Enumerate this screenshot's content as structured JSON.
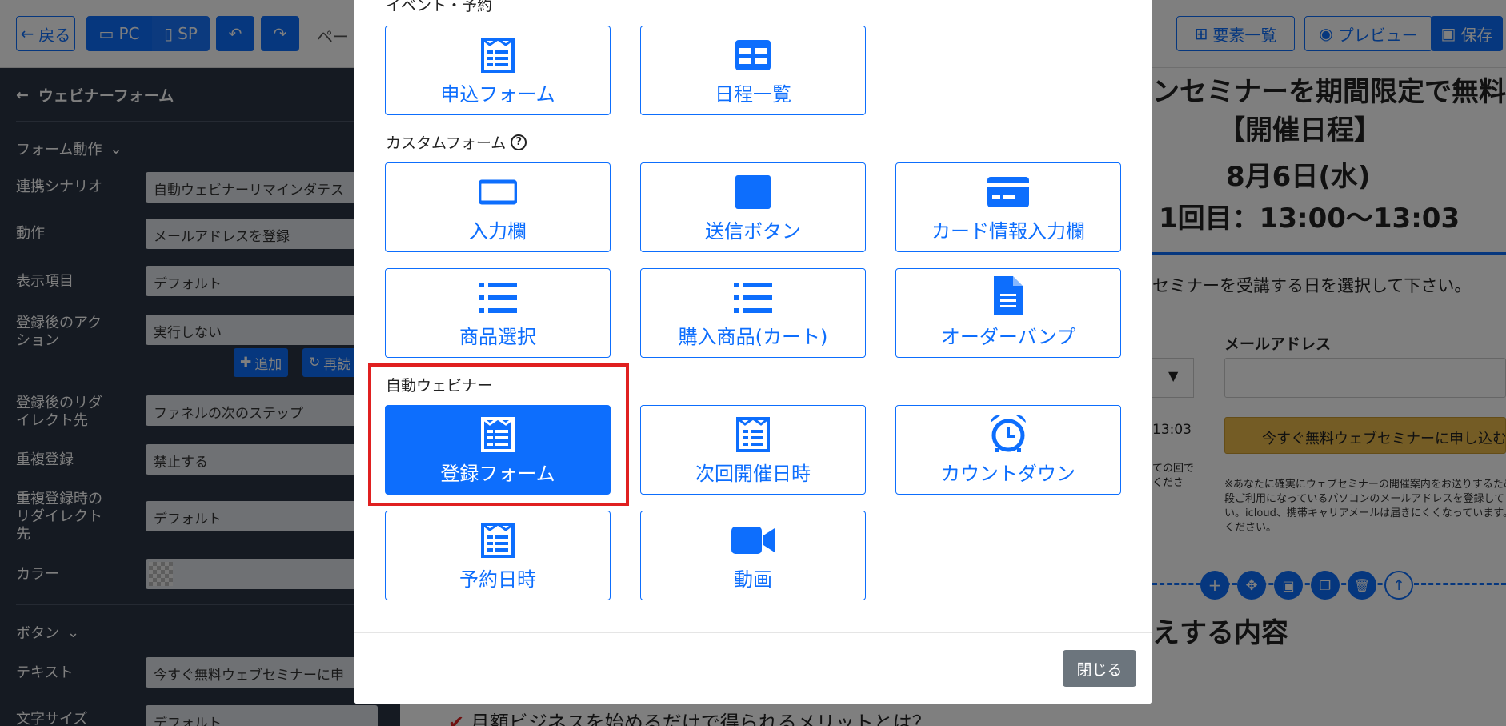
{
  "toolbar": {
    "back_label": "戻る",
    "pc_label": "PC",
    "sp_label": "SP",
    "page_label": "ペー",
    "elements_label": "要素一覧",
    "preview_label": "プレビュー",
    "save_label": "保存"
  },
  "sidebar": {
    "title": "ウェビナーフォーム",
    "section_form": "フォーム動作",
    "rows": [
      {
        "label": "連携シナリオ",
        "value": "自動ウェビナーリマインダテス"
      },
      {
        "label": "動作",
        "value": "メールアドレスを登録"
      },
      {
        "label": "表示項目",
        "value": "デフォルト"
      },
      {
        "label": "登録後のアクション",
        "value": "実行しない"
      },
      {
        "label": "登録後のリダイレクト先",
        "value": "ファネルの次のステップ"
      },
      {
        "label": "重複登録",
        "value": "禁止する"
      },
      {
        "label": "重複登録時のリダイレクト先",
        "value": "デフォルト"
      },
      {
        "label": "カラー",
        "value": ""
      }
    ],
    "add_label": "追加",
    "refresh_label": "再読",
    "section_button": "ボタン",
    "text_label": "テキスト",
    "text_value": "今すぐ無料ウェブセミナーに申",
    "fontsize_label": "文字サイズ",
    "fontsize_value": "デフォルト"
  },
  "canvas": {
    "heading_partial": "ンセミナーを期間限定で無料",
    "schedule_title": "【開催日程】",
    "date": "8月6日(水)",
    "time": "1回目：13:00〜13:03",
    "instruction": "セミナーを受講する日を選択して下さい。",
    "email_label": "メールアドレス",
    "time_partial": "13:03",
    "cta": "今すぐ無料ウェブセミナーに申し込む",
    "note_left": "ての回で\nくださ",
    "note": "※あなたに確実にウェブセミナーの開催案内をお送りするため\n段ご利用になっているパソコンのメールアドレスを登録してく\nい。icloud、携帯キャリアメールは届きにくくなっています。\nください。",
    "section2_partial": "えする内容",
    "bottom_text": "月額ビジネスを始めるだけで得られるメリットとは？"
  },
  "modal": {
    "section_event": "イベント・予約",
    "section_custom": "カスタムフォーム",
    "section_webinar": "自動ウェビナー",
    "event_tiles": [
      {
        "label": "申込フォーム",
        "icon": "form-icon"
      },
      {
        "label": "日程一覧",
        "icon": "grid-icon"
      }
    ],
    "custom_tiles": [
      {
        "label": "入力欄",
        "icon": "input-box-icon"
      },
      {
        "label": "送信ボタン",
        "icon": "square-icon"
      },
      {
        "label": "カード情報入力欄",
        "icon": "credit-card-icon"
      },
      {
        "label": "商品選択",
        "icon": "list-icon"
      },
      {
        "label": "購入商品(カート)",
        "icon": "list-icon"
      },
      {
        "label": "オーダーバンプ",
        "icon": "document-icon"
      }
    ],
    "webinar_tiles": [
      {
        "label": "登録フォーム",
        "icon": "form-icon",
        "active": true
      },
      {
        "label": "次回開催日時",
        "icon": "form-icon"
      },
      {
        "label": "カウントダウン",
        "icon": "alarm-clock-icon"
      },
      {
        "label": "予約日時",
        "icon": "form-icon"
      },
      {
        "label": "動画",
        "icon": "video-camera-icon"
      }
    ],
    "close_label": "閉じる"
  },
  "colors": {
    "primary": "#0d6efd",
    "highlight": "#e02020",
    "sidebar_bg": "#2b3544",
    "close_btn": "#6c757d",
    "cta_gold": "#e8b84a"
  }
}
